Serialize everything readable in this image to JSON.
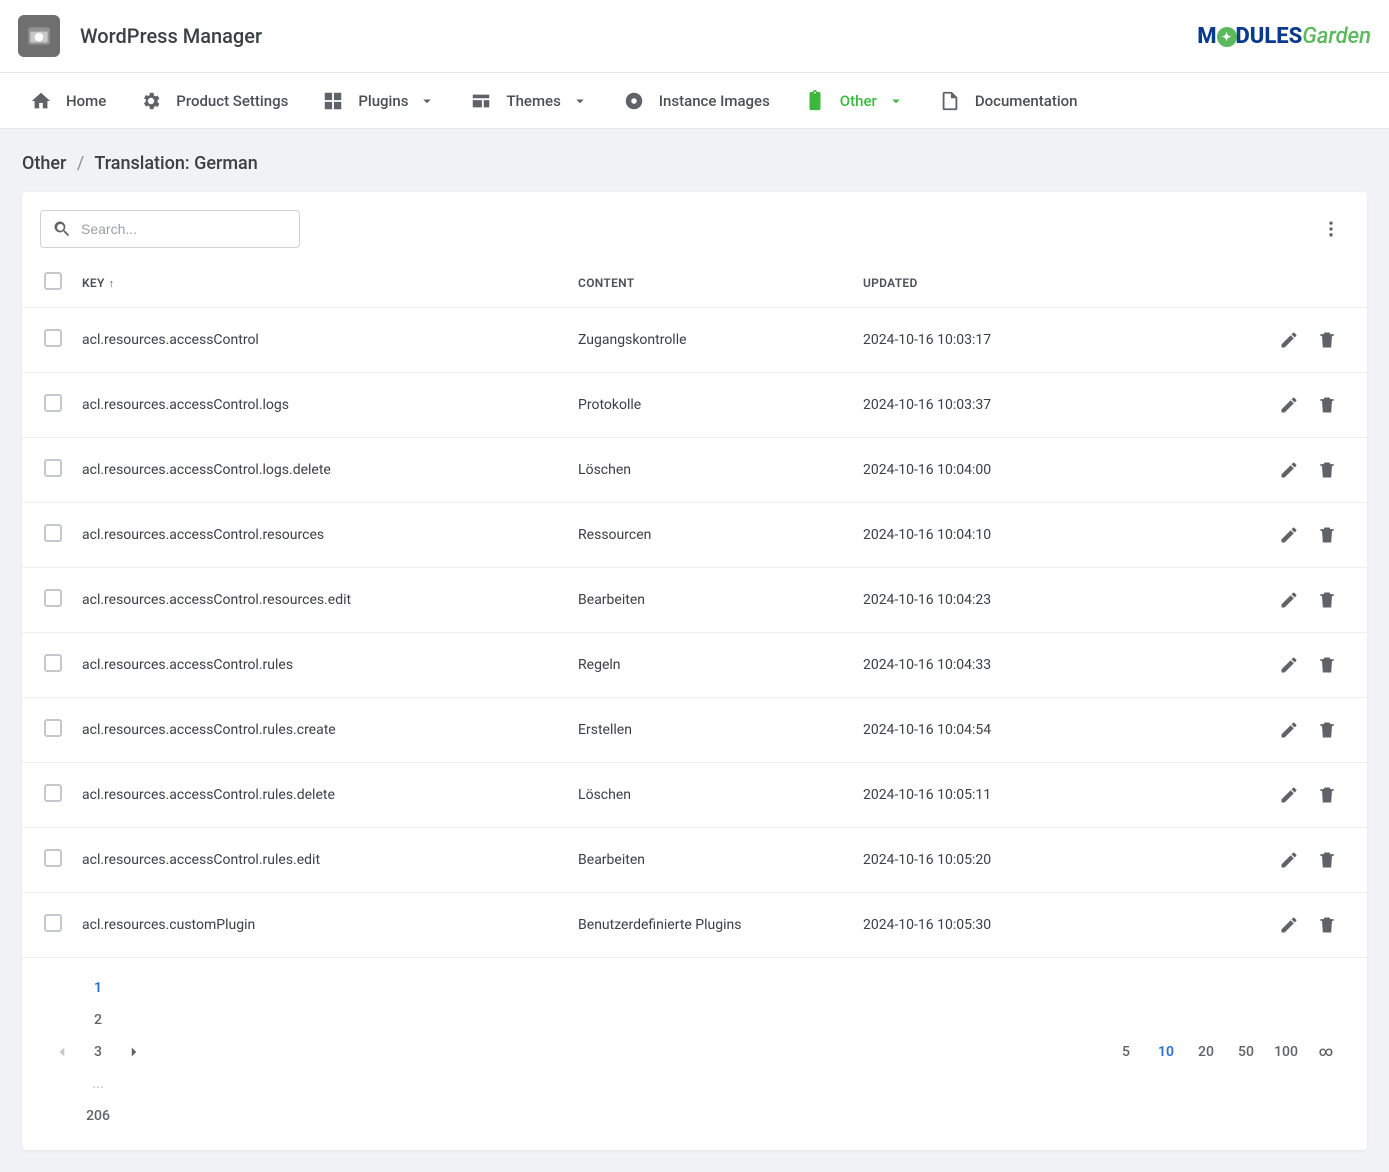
{
  "header": {
    "app_title": "WordPress Manager",
    "logo_m": "M",
    "logo_dules": "DULES",
    "logo_garden": "Garden"
  },
  "nav": {
    "home": "Home",
    "product_settings": "Product Settings",
    "plugins": "Plugins",
    "themes": "Themes",
    "instance_images": "Instance Images",
    "other": "Other",
    "documentation": "Documentation"
  },
  "breadcrumb": {
    "root": "Other",
    "sep": "/",
    "current": "Translation: German"
  },
  "search": {
    "placeholder": "Search..."
  },
  "columns": {
    "key": "KEY",
    "content": "CONTENT",
    "updated": "UPDATED"
  },
  "rows": [
    {
      "key": "acl.resources.accessControl",
      "content": "Zugangskontrolle",
      "updated": "2024-10-16 10:03:17"
    },
    {
      "key": "acl.resources.accessControl.logs",
      "content": "Protokolle",
      "updated": "2024-10-16 10:03:37"
    },
    {
      "key": "acl.resources.accessControl.logs.delete",
      "content": "Löschen",
      "updated": "2024-10-16 10:04:00"
    },
    {
      "key": "acl.resources.accessControl.resources",
      "content": "Ressourcen",
      "updated": "2024-10-16 10:04:10"
    },
    {
      "key": "acl.resources.accessControl.resources.edit",
      "content": "Bearbeiten",
      "updated": "2024-10-16 10:04:23"
    },
    {
      "key": "acl.resources.accessControl.rules",
      "content": "Regeln",
      "updated": "2024-10-16 10:04:33"
    },
    {
      "key": "acl.resources.accessControl.rules.create",
      "content": "Erstellen",
      "updated": "2024-10-16 10:04:54"
    },
    {
      "key": "acl.resources.accessControl.rules.delete",
      "content": "Löschen",
      "updated": "2024-10-16 10:05:11"
    },
    {
      "key": "acl.resources.accessControl.rules.edit",
      "content": "Bearbeiten",
      "updated": "2024-10-16 10:05:20"
    },
    {
      "key": "acl.resources.customPlugin",
      "content": "Benutzerdefinierte Plugins",
      "updated": "2024-10-16 10:05:30"
    }
  ],
  "pagination": {
    "pages": [
      "1",
      "2",
      "3",
      "...",
      "206"
    ],
    "current_page": "1",
    "sizes": [
      "5",
      "10",
      "20",
      "50",
      "100",
      "∞"
    ],
    "current_size": "10"
  }
}
